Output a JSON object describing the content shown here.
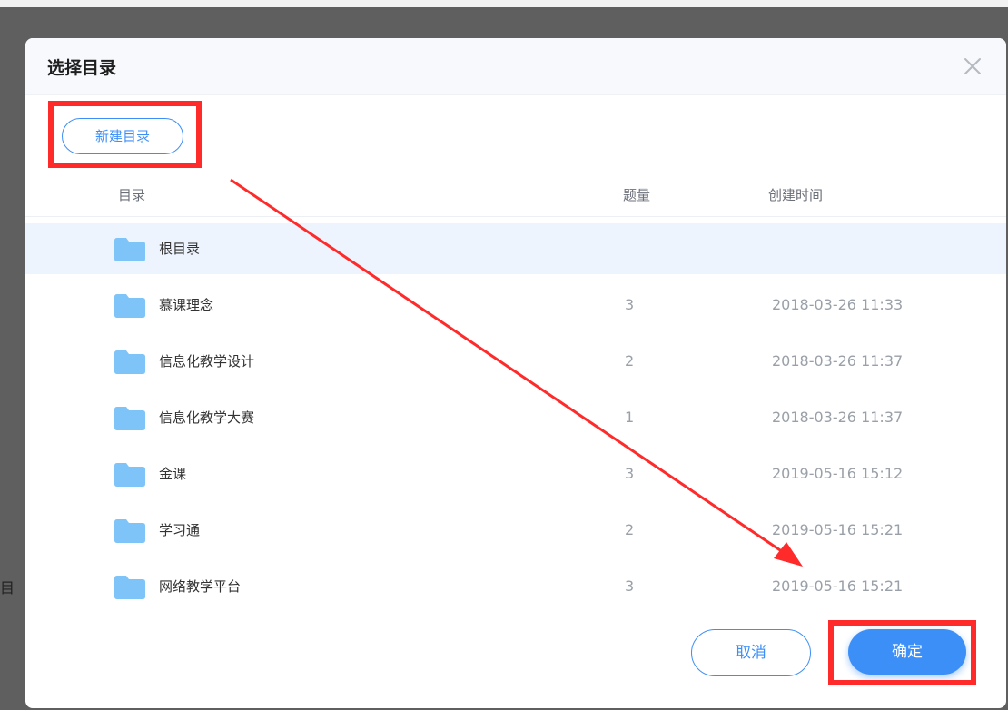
{
  "dialog": {
    "title": "选择目录",
    "close_icon": "close-icon",
    "new_dir_label": "新建目录",
    "cancel_label": "取消",
    "ok_label": "确定"
  },
  "table": {
    "columns": [
      "目录",
      "题量",
      "创建时间"
    ],
    "rows": [
      {
        "name": "根目录",
        "count": "",
        "time": "",
        "selected": true
      },
      {
        "name": "慕课理念",
        "count": "3",
        "time": "2018-03-26 11:33"
      },
      {
        "name": "信息化教学设计",
        "count": "2",
        "time": "2018-03-26 11:37"
      },
      {
        "name": "信息化教学大赛",
        "count": "1",
        "time": "2018-03-26 11:37"
      },
      {
        "name": "金课",
        "count": "3",
        "time": "2019-05-16 15:12"
      },
      {
        "name": "学习通",
        "count": "2",
        "time": "2019-05-16 15:21"
      },
      {
        "name": "网络教学平台",
        "count": "3",
        "time": "2019-05-16 15:21"
      }
    ]
  },
  "background": {
    "fragment_text": "目名"
  },
  "colors": {
    "accent": "#3d8ff8",
    "folder": "#7fc4f8",
    "annotation_red": "#ff2a2a",
    "selected_row": "#eef4fd"
  },
  "annotations": {
    "highlight_boxes": [
      "new-dir-button",
      "ok-button"
    ],
    "arrow": "from new-dir-button to ok-button"
  }
}
